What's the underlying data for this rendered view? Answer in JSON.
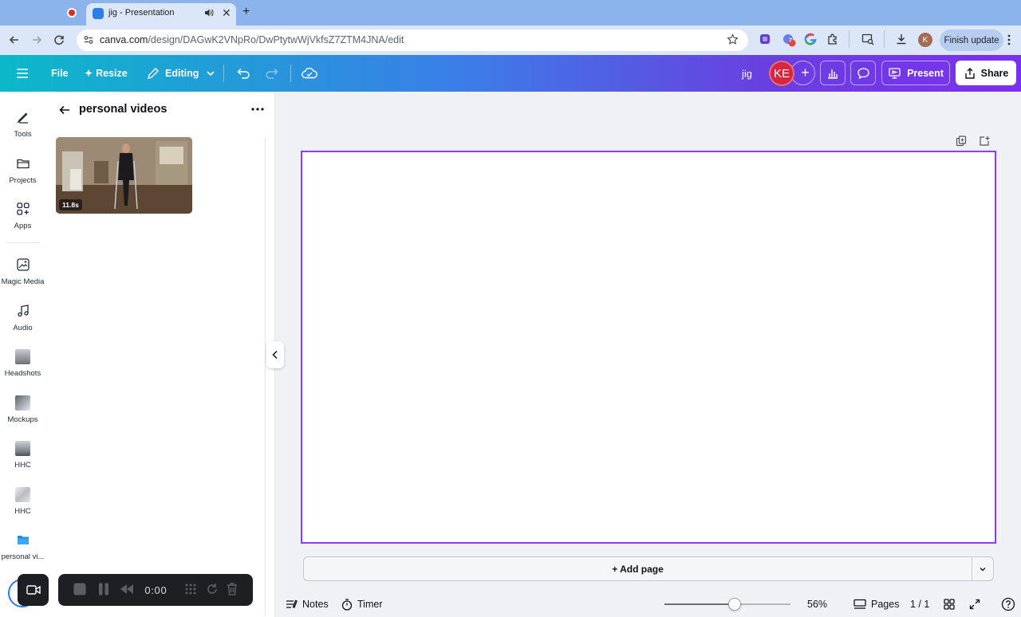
{
  "browser": {
    "tab_title": "jig - Presentation",
    "url_host": "canva.com",
    "url_path": "/design/DAGwK2VNpRo/DwPtytwWjVkfsZ7ZTM4JNA/edit",
    "profile_initial": "K",
    "finish_update_label": "Finish update",
    "extension_badge": "7"
  },
  "toolbar": {
    "file_label": "File",
    "resize_label": "Resize",
    "editing_label": "Editing",
    "design_name": "jig",
    "avatar_initials": "KE",
    "present_label": "Present",
    "share_label": "Share"
  },
  "rail": {
    "tools": "Tools",
    "projects": "Projects",
    "apps": "Apps",
    "magic_media": "Magic Media",
    "audio": "Audio",
    "headshots": "Headshots",
    "mockups": "Mockups",
    "hhc_1": "HHC",
    "hhc_2": "HHC",
    "personal_videos": "personal vi..."
  },
  "panel": {
    "title": "personal videos",
    "video": {
      "duration": "11.8s"
    }
  },
  "canvas": {
    "add_page_label": "+ Add page"
  },
  "bottom": {
    "notes_label": "Notes",
    "timer_label": "Timer",
    "zoom_percent": "56%",
    "zoom_level": 0.56,
    "pages_label": "Pages",
    "page_count": "1 / 1"
  },
  "recorder": {
    "elapsed": "0:00"
  },
  "colors": {
    "brand_purple": "#8b3dff",
    "avatar_red": "#d7263d"
  }
}
